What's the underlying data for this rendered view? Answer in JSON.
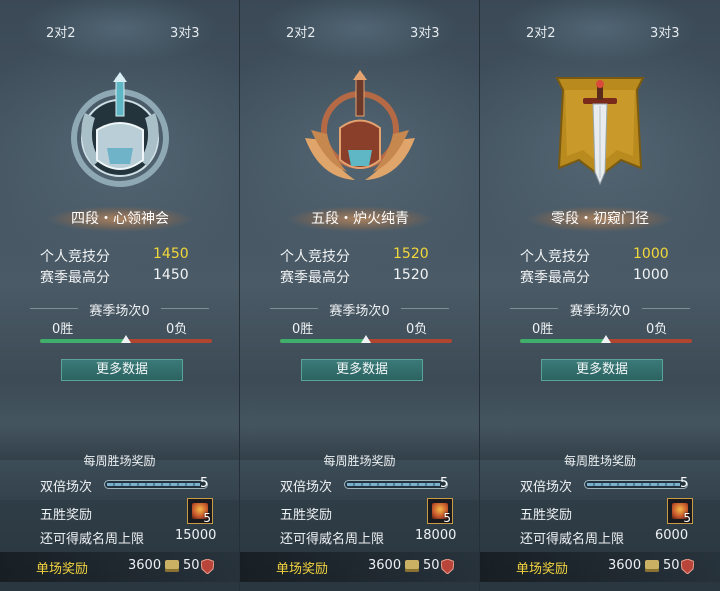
{
  "columns": [
    {
      "tab_left": "2对2",
      "tab_right": "3对3",
      "emblem_icon": "silver-helmet-emblem-icon",
      "rank_title": "四段・心领神会",
      "personal_score_label": "个人竞技分",
      "personal_score": "1450",
      "season_high_label": "赛季最高分",
      "season_high": "1450",
      "season_matches": "赛季场次0",
      "wins": "0胜",
      "losses": "0负",
      "win_ratio": 0.5,
      "more_data": "更多数据",
      "weekly_rewards": "每周胜场奖励",
      "double_label": "双倍场次",
      "double_count": "5",
      "double_fill": 0.95,
      "five_win_label": "五胜奖励",
      "chest_count": "5",
      "cap_label": "还可得威名周上限",
      "cap_value": "15000",
      "single_reward_label": "单场奖励",
      "coin_amount": "3600",
      "medal_amount": "50"
    },
    {
      "tab_left": "2对2",
      "tab_right": "3对3",
      "emblem_icon": "bronze-winged-helmet-emblem-icon",
      "rank_title": "五段・炉火纯青",
      "personal_score_label": "个人竞技分",
      "personal_score": "1520",
      "season_high_label": "赛季最高分",
      "season_high": "1520",
      "season_matches": "赛季场次0",
      "wins": "0胜",
      "losses": "0负",
      "win_ratio": 0.5,
      "more_data": "更多数据",
      "weekly_rewards": "每周胜场奖励",
      "double_label": "双倍场次",
      "double_count": "5",
      "double_fill": 0.95,
      "five_win_label": "五胜奖励",
      "chest_count": "5",
      "cap_label": "还可得威名周上限",
      "cap_value": "18000",
      "single_reward_label": "单场奖励",
      "coin_amount": "3600",
      "medal_amount": "50"
    },
    {
      "tab_left": "2对2",
      "tab_right": "3对3",
      "emblem_icon": "sword-banner-emblem-icon",
      "rank_title": "零段・初窥门径",
      "personal_score_label": "个人竞技分",
      "personal_score": "1000",
      "season_high_label": "赛季最高分",
      "season_high": "1000",
      "season_matches": "赛季场次0",
      "wins": "0胜",
      "losses": "0负",
      "win_ratio": 0.5,
      "more_data": "更多数据",
      "weekly_rewards": "每周胜场奖励",
      "double_label": "双倍场次",
      "double_count": "5",
      "double_fill": 0.95,
      "five_win_label": "五胜奖励",
      "chest_count": "5",
      "cap_label": "还可得威名周上限",
      "cap_value": "6000",
      "single_reward_label": "单场奖励",
      "coin_amount": "3600",
      "medal_amount": "50"
    }
  ],
  "colors": {
    "score_highlight": "#f4d83a",
    "reward_label": "#f2d33f",
    "win_bar": "#3fae6a",
    "loss_bar": "#b0462f",
    "button": "#2c6361"
  }
}
